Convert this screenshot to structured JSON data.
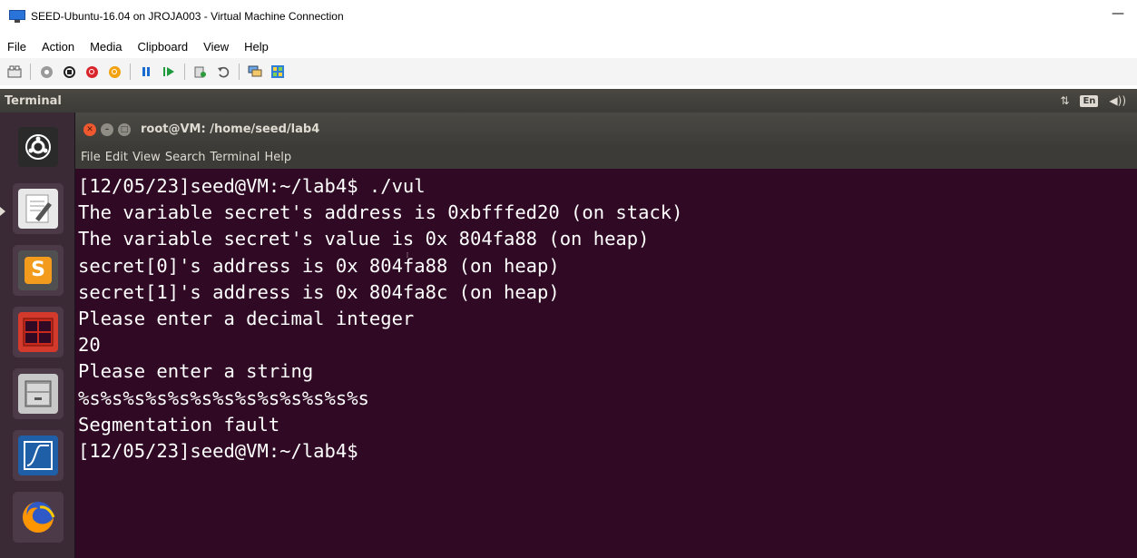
{
  "window": {
    "title": "SEED-Ubuntu-16.04 on JROJA003 - Virtual Machine Connection",
    "minimize": "—"
  },
  "menu": [
    "File",
    "Action",
    "Media",
    "Clipboard",
    "View",
    "Help"
  ],
  "toolbar_icons": [
    "ctrl-alt-del-icon",
    "start-icon",
    "turn-off-icon",
    "shut-down-icon",
    "power-icon",
    "pause-icon",
    "resume-icon",
    "checkpoint-icon",
    "revert-icon",
    "enhanced-session-icon",
    "zoom-icon"
  ],
  "topbar": {
    "app_name": "Terminal",
    "indicators": {
      "network": "⇅",
      "keyboard": "En",
      "sound": "◀))"
    }
  },
  "launcher": [
    "dash-icon",
    "text-editor-icon",
    "sublime-text-icon",
    "terminal-icon",
    "file-manager-icon",
    "wireshark-icon",
    "firefox-icon"
  ],
  "terminal": {
    "title": "root@VM: /home/seed/lab4",
    "menu": [
      "File",
      "Edit",
      "View",
      "Search",
      "Terminal",
      "Help"
    ],
    "lines": [
      "[12/05/23]seed@VM:~/lab4$ ./vul",
      "The variable secret's address is 0xbfffed20 (on stack)",
      "The variable secret's value is 0x 804fa88 (on heap)",
      "secret[0]'s address is 0x 804fa88 (on heap)",
      "secret[1]'s address is 0x 804fa8c (on heap)",
      "Please enter a decimal integer",
      "20",
      "Please enter a string",
      "%s%s%s%s%s%s%s%s%s%s%s%s%s",
      "Segmentation fault",
      "[12/05/23]seed@VM:~/lab4$"
    ]
  },
  "colors": {
    "terminal_bg": "#300a24",
    "launcher_bg": "#3a2a36",
    "titlebar_bg": "#3c3b37"
  }
}
